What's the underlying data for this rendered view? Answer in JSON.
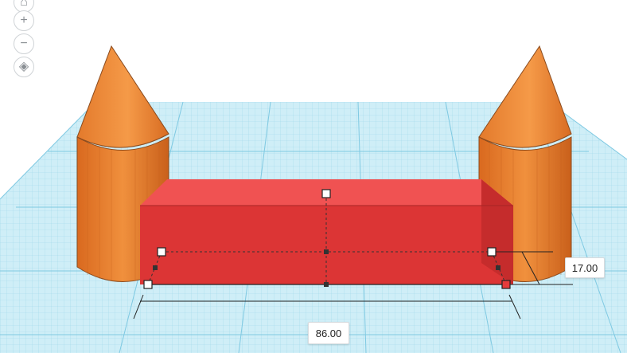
{
  "viewport": {
    "nav_icons": [
      "home-icon",
      "zoom-in-icon",
      "zoom-out-icon",
      "view-cube-icon"
    ],
    "nav_glyphs": [
      "⌂",
      "+",
      "−",
      "◈"
    ]
  },
  "scene": {
    "workplane_color": "#cfeef7",
    "grid_line_color": "#7fc9e2",
    "box_color": "#e43a3a",
    "cone_color": "#f08a37",
    "cylinder_color": "#e77a2a"
  },
  "dimensions": {
    "height_value": "17.00",
    "length_value": "86.00"
  }
}
